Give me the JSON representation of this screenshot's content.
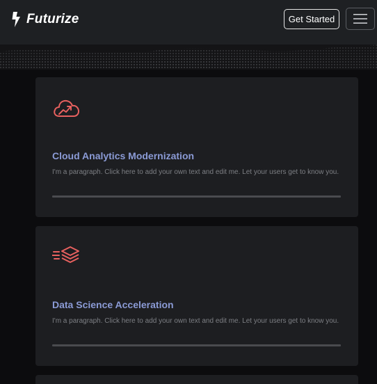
{
  "header": {
    "brand": "Futurize",
    "get_started_label": "Get Started"
  },
  "cards": [
    {
      "title": "Cloud Analytics Modernization",
      "text": "I'm a paragraph. Click here to add your own text and edit me. Let your users get to know you.",
      "icon": "cloud-analytics-icon"
    },
    {
      "title": "Data Science Acceleration",
      "text": "I'm a paragraph. Click here to add your own text and edit me. Let your users get to know you.",
      "icon": "layers-speed-icon"
    }
  ],
  "colors": {
    "accent": "#e8615f",
    "title": "#8b9bd6",
    "header_bg": "#1e2023",
    "card_bg": "#1d1e21"
  }
}
